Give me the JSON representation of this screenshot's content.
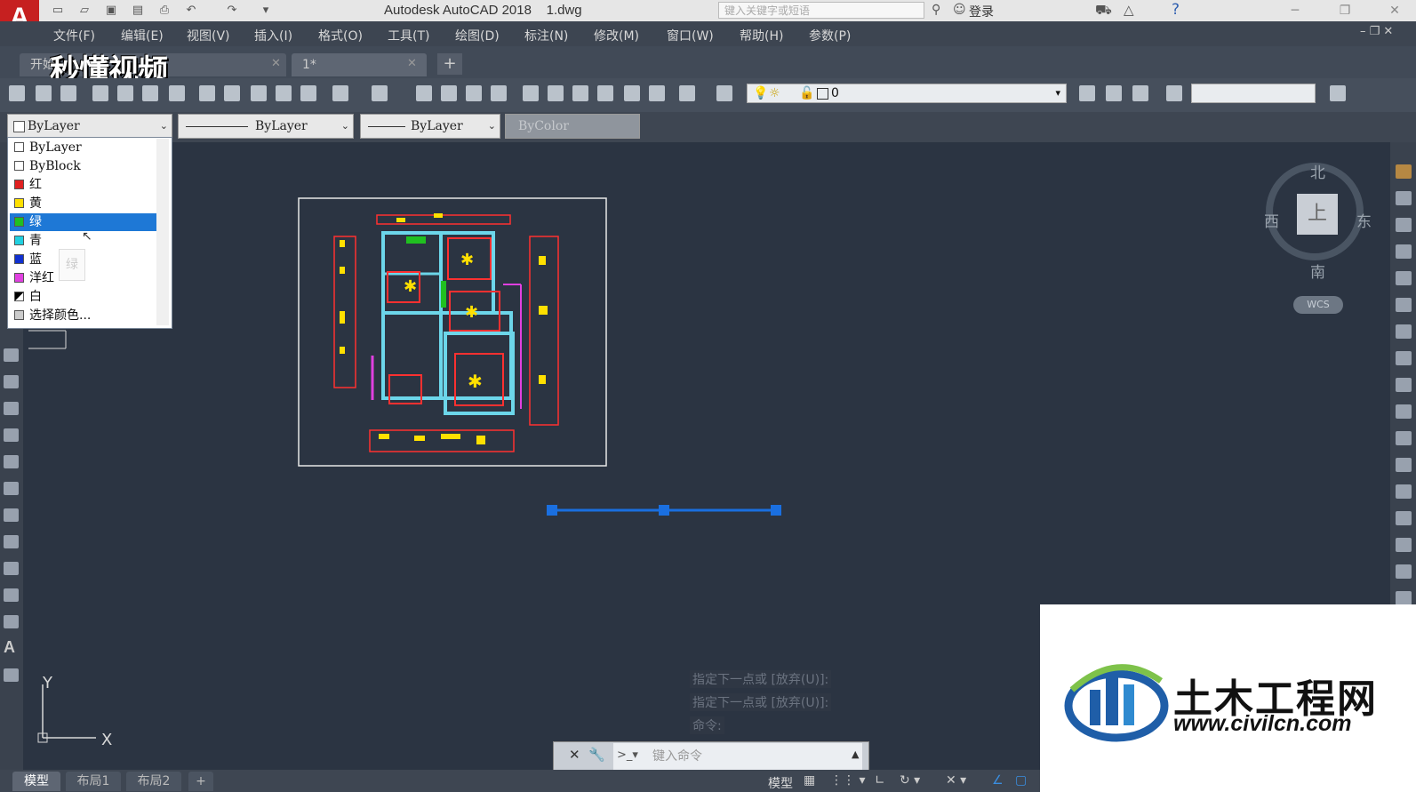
{
  "app": {
    "logo": "A",
    "title": "Autodesk AutoCAD 2018    1.dwg",
    "search_placeholder": "键入关键字或短语",
    "login": "登录"
  },
  "menu": [
    "文件(F)",
    "编辑(E)",
    "视图(V)",
    "插入(I)",
    "格式(O)",
    "工具(T)",
    "绘图(D)",
    "标注(N)",
    "修改(M)",
    "窗口(W)",
    "帮助(H)",
    "参数(P)"
  ],
  "tabs": {
    "start": "开始",
    "doc": "1*"
  },
  "watermark": "秒懂视频",
  "layer_combo_value": "0",
  "properties": {
    "color": "ByLayer",
    "linetype": "ByLayer",
    "lineweight": "ByLayer",
    "plotstyle": "ByColor"
  },
  "color_dropdown": [
    {
      "label": "ByLayer",
      "swatch": "#ffffff"
    },
    {
      "label": "ByBlock",
      "swatch": "#ffffff"
    },
    {
      "label": "红",
      "swatch": "#e02020"
    },
    {
      "label": "黄",
      "swatch": "#ffe000"
    },
    {
      "label": "绿",
      "swatch": "#20c020",
      "selected": true
    },
    {
      "label": "青",
      "swatch": "#20d0e0"
    },
    {
      "label": "蓝",
      "swatch": "#1030d0"
    },
    {
      "label": "洋红",
      "swatch": "#e040e0"
    },
    {
      "label": "白",
      "swatch": "#ffffff"
    },
    {
      "label": "选择颜色...",
      "swatch": "#cccccc"
    }
  ],
  "tooltip_ghost": "绿",
  "viewcube": {
    "north": "北",
    "south": "南",
    "west": "西",
    "east": "东",
    "face": "上",
    "wcs": "WCS"
  },
  "ucs": {
    "x": "X",
    "y": "Y"
  },
  "command_history": [
    "指定下一点或 [放弃(U)]:",
    "指定下一点或 [放弃(U)]:",
    "命令:"
  ],
  "command_placeholder": "键入命令",
  "layout_tabs": [
    "模型",
    "布局1",
    "布局2"
  ],
  "status": {
    "model": "模型"
  },
  "site_logo": {
    "name": "土木工程网",
    "url": "www.civilcn.com"
  },
  "colors": {
    "canvas": "#2b3442",
    "selected_item": "#1e78d6",
    "grip": "#1a6fe0"
  }
}
